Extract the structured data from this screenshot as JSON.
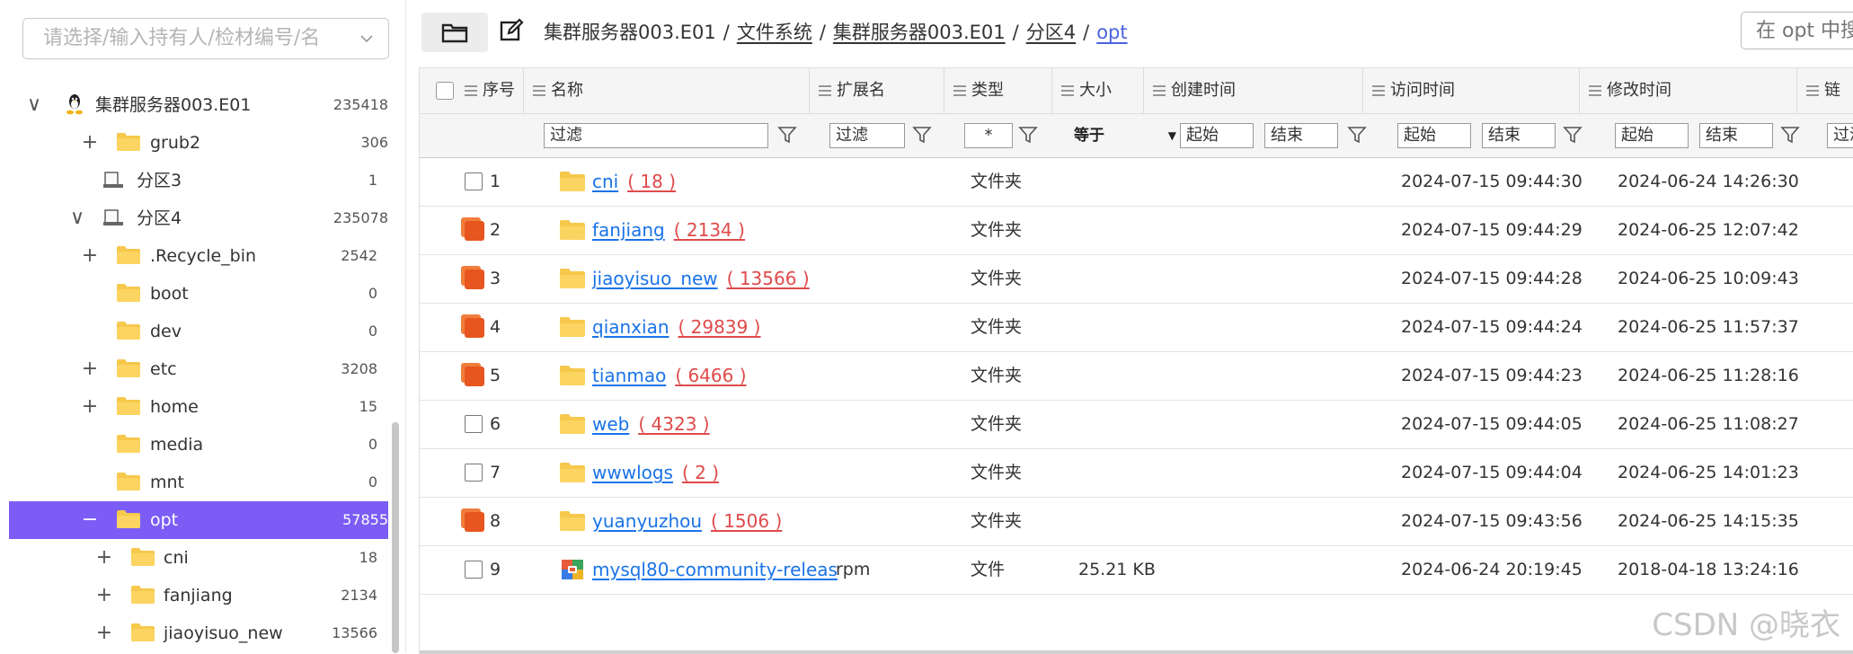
{
  "sidebar": {
    "selector_placeholder": "请选择/输入持有人/检材编号/名",
    "tree": [
      {
        "label": "集群服务器003.E01",
        "count": "235418",
        "expander": "∨",
        "icon": "linux-icon"
      },
      {
        "label": "grub2",
        "count": "306",
        "expander": "+",
        "icon": "folder-icon"
      },
      {
        "label": "分区3",
        "count": "1",
        "expander": "",
        "icon": "drive-icon"
      },
      {
        "label": "分区4",
        "count": "235078",
        "expander": "∨",
        "icon": "drive-icon"
      },
      {
        "label": ".Recycle_bin",
        "count": "2542",
        "expander": "+",
        "icon": "folder-icon"
      },
      {
        "label": "boot",
        "count": "0",
        "expander": "",
        "icon": "folder-icon"
      },
      {
        "label": "dev",
        "count": "0",
        "expander": "",
        "icon": "folder-icon"
      },
      {
        "label": "etc",
        "count": "3208",
        "expander": "+",
        "icon": "folder-icon"
      },
      {
        "label": "home",
        "count": "15",
        "expander": "+",
        "icon": "folder-icon"
      },
      {
        "label": "media",
        "count": "0",
        "expander": "",
        "icon": "folder-icon"
      },
      {
        "label": "mnt",
        "count": "0",
        "expander": "",
        "icon": "folder-icon"
      },
      {
        "label": "opt",
        "count": "57855",
        "expander": "−",
        "icon": "folder-icon",
        "selected": true
      },
      {
        "label": "cni",
        "count": "18",
        "expander": "+",
        "icon": "folder-icon"
      },
      {
        "label": "fanjiang",
        "count": "2134",
        "expander": "+",
        "icon": "folder-icon"
      },
      {
        "label": "jiaoyisuo_new",
        "count": "13566",
        "expander": "+",
        "icon": "folder-icon"
      }
    ]
  },
  "toolbar": {
    "breadcrumb": [
      "集群服务器003.E01",
      "文件系统",
      "集群服务器003.E01",
      "分区4"
    ],
    "current": "opt",
    "search_placeholder": "在 opt 中搜索"
  },
  "table": {
    "headers": {
      "index": "序号",
      "name": "名称",
      "ext": "扩展名",
      "type": "类型",
      "size": "大小",
      "created": "创建时间",
      "accessed": "访问时间",
      "modified": "修改时间",
      "last": "链"
    },
    "filters": {
      "name": "过滤",
      "ext": "过滤",
      "type": "*",
      "size_op": "等于",
      "start": "起始",
      "end": "结束",
      "last": "过滤"
    },
    "rows": [
      {
        "idx": "1",
        "name": "cni",
        "count": "( 18 )",
        "ext": "",
        "type": "文件夹",
        "size": "",
        "atime": "2024-07-15 09:44:30",
        "mtime": "2024-06-24 14:26:30",
        "marked": false,
        "kind": "folder"
      },
      {
        "idx": "2",
        "name": "fanjiang",
        "count": "( 2134 )",
        "ext": "",
        "type": "文件夹",
        "size": "",
        "atime": "2024-07-15 09:44:29",
        "mtime": "2024-06-25 12:07:42",
        "marked": true,
        "kind": "folder"
      },
      {
        "idx": "3",
        "name": "jiaoyisuo_new",
        "count": "( 13566 )",
        "ext": "",
        "type": "文件夹",
        "size": "",
        "atime": "2024-07-15 09:44:28",
        "mtime": "2024-06-25 10:09:43",
        "marked": true,
        "kind": "folder"
      },
      {
        "idx": "4",
        "name": "qianxian",
        "count": "( 29839 )",
        "ext": "",
        "type": "文件夹",
        "size": "",
        "atime": "2024-07-15 09:44:24",
        "mtime": "2024-06-25 11:57:37",
        "marked": true,
        "kind": "folder"
      },
      {
        "idx": "5",
        "name": "tianmao",
        "count": "( 6466 )",
        "ext": "",
        "type": "文件夹",
        "size": "",
        "atime": "2024-07-15 09:44:23",
        "mtime": "2024-06-25 11:28:16",
        "marked": true,
        "kind": "folder"
      },
      {
        "idx": "6",
        "name": "web",
        "count": "( 4323 )",
        "ext": "",
        "type": "文件夹",
        "size": "",
        "atime": "2024-07-15 09:44:05",
        "mtime": "2024-06-25 11:08:27",
        "marked": false,
        "kind": "folder"
      },
      {
        "idx": "7",
        "name": "wwwlogs",
        "count": "( 2 )",
        "ext": "",
        "type": "文件夹",
        "size": "",
        "atime": "2024-07-15 09:44:04",
        "mtime": "2024-06-25 14:01:23",
        "marked": false,
        "kind": "folder"
      },
      {
        "idx": "8",
        "name": "yuanyuzhou",
        "count": "( 1506 )",
        "ext": "",
        "type": "文件夹",
        "size": "",
        "atime": "2024-07-15 09:43:56",
        "mtime": "2024-06-25 14:15:35",
        "marked": true,
        "kind": "folder"
      },
      {
        "idx": "9",
        "name": "mysql80-community-releas",
        "count": "",
        "ext": "rpm",
        "type": "文件",
        "size": "25.21 KB",
        "atime": "2024-06-24 20:19:45",
        "mtime": "2018-04-18 13:24:16",
        "marked": false,
        "kind": "rpm"
      }
    ]
  },
  "watermark": "CSDN @晓衣"
}
